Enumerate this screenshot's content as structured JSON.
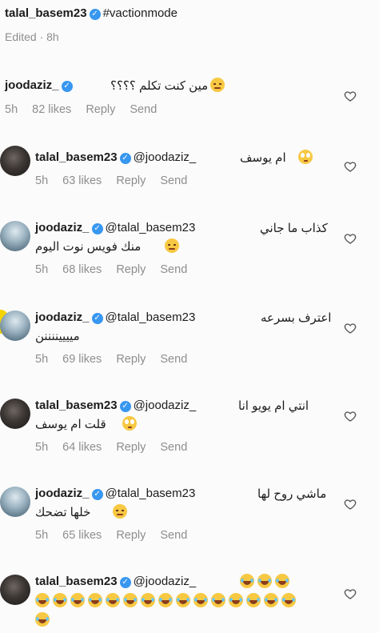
{
  "caption": {
    "username": "talal_basem23",
    "hashtag": "#vactionmode",
    "edited": "Edited · 8h"
  },
  "labels": {
    "reply": "Reply",
    "send": "Send"
  },
  "comments": [
    {
      "username": "joodaziz_",
      "mention": "",
      "line1": "مين كنت تكلم ؟؟؟؟",
      "line2": "",
      "time": "5h",
      "likes": "82 likes",
      "emoji": "sad"
    },
    {
      "username": "talal_basem23",
      "mention": "@joodaziz_",
      "line1": "ام يوسف",
      "line2": "",
      "time": "5h",
      "likes": "63 likes",
      "emoji": "eyes"
    },
    {
      "username": "joodaziz_",
      "mention": "@talal_basem23",
      "line1": "كذاب ما جاني",
      "line2": "منك فويس نوت اليوم",
      "time": "5h",
      "likes": "68 likes",
      "emoji": "sad"
    },
    {
      "username": "joodaziz_",
      "mention": "@talal_basem23",
      "line1": "اعترف بسرعه",
      "line2": "مييييننننن",
      "time": "5h",
      "likes": "69 likes",
      "emoji": ""
    },
    {
      "username": "talal_basem23",
      "mention": "@joodaziz_",
      "line1": "انتي ام يويو انا",
      "line2": "قلت ام يوسف",
      "time": "5h",
      "likes": "64 likes",
      "emoji": "eyes"
    },
    {
      "username": "joodaziz_",
      "mention": "@talal_basem23",
      "line1": "ماشي روح لها",
      "line2": "خلها تضحك",
      "time": "5h",
      "likes": "65 likes",
      "emoji": "sad"
    },
    {
      "username": "talal_basem23",
      "mention": "@joodaziz_",
      "line1": "",
      "line2": "",
      "time": "",
      "likes": "",
      "emoji": "laugh"
    }
  ],
  "icons": {
    "verified": "verified-badge-icon",
    "like": "heart-outline-icon"
  }
}
